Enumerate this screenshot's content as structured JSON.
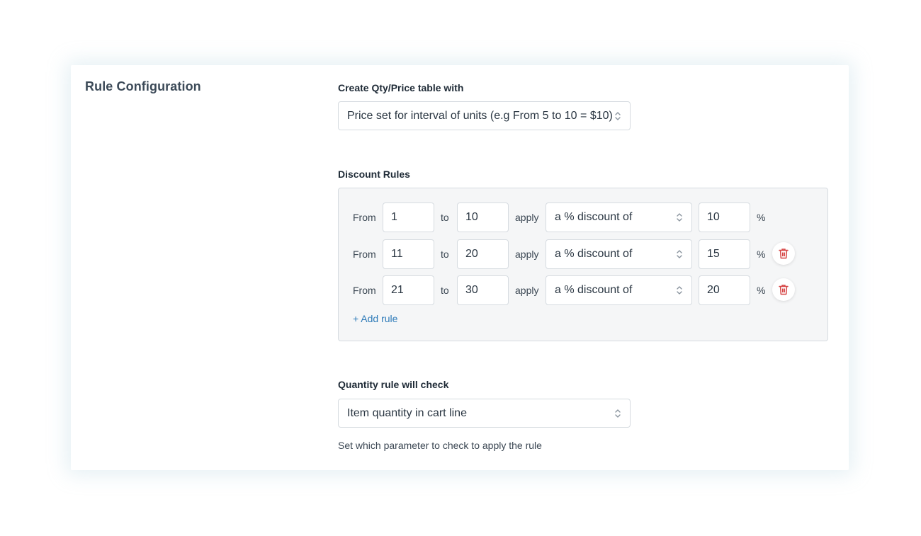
{
  "section": {
    "title": "Rule Configuration"
  },
  "table_type": {
    "label": "Create Qty/Price table with",
    "selected": "Price set for interval of units (e.g From 5 to 10 = $10)"
  },
  "discount_rules": {
    "label": "Discount Rules",
    "from_label": "From",
    "to_label": "to",
    "apply_label": "apply",
    "unit": "%",
    "rows": [
      {
        "from": "1",
        "to": "10",
        "type": "a % discount of",
        "amount": "10",
        "deletable": false
      },
      {
        "from": "11",
        "to": "20",
        "type": "a % discount of",
        "amount": "15",
        "deletable": true
      },
      {
        "from": "21",
        "to": "30",
        "type": "a % discount of",
        "amount": "20",
        "deletable": true
      }
    ],
    "add_label": "+ Add rule"
  },
  "quantity_check": {
    "label": "Quantity rule will check",
    "selected": "Item quantity in cart line",
    "help": "Set which parameter to check to apply the rule"
  },
  "icons": {
    "select_chevron": "chevron-up-down-icon",
    "delete": "trash-icon"
  },
  "colors": {
    "accent": "#2d7ab8",
    "danger": "#d64545",
    "panel_bg": "#f5f6f7",
    "border": "#d6dbe0"
  }
}
